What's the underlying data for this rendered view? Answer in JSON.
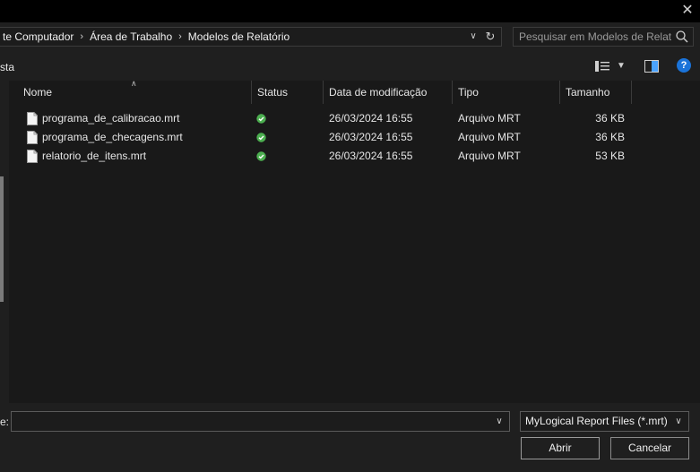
{
  "window": {
    "close_glyph": "✕"
  },
  "addressbar": {
    "crumbs": [
      "te Computador",
      "Área de Trabalho",
      "Modelos de Relatório"
    ],
    "separator": "›"
  },
  "search": {
    "placeholder": "Pesquisar em Modelos de Relat..."
  },
  "toolbar": {
    "label": "sta"
  },
  "columns": [
    "Nome",
    "Status",
    "Data de modificação",
    "Tipo",
    "Tamanho"
  ],
  "files": [
    {
      "name": "programa_de_calibracao.mrt",
      "modified": "26/03/2024 16:55",
      "type": "Arquivo MRT",
      "size": "36 KB"
    },
    {
      "name": "programa_de_checagens.mrt",
      "modified": "26/03/2024 16:55",
      "type": "Arquivo MRT",
      "size": "36 KB"
    },
    {
      "name": "relatorio_de_itens.mrt",
      "modified": "26/03/2024 16:55",
      "type": "Arquivo MRT",
      "size": "53 KB"
    }
  ],
  "footer": {
    "filename_label": "e:",
    "filename_value": "",
    "filetype": "MyLogical Report Files (*.mrt)",
    "open_label": "Abrir",
    "cancel_label": "Cancelar"
  },
  "colors": {
    "status_ok": "#4caf50",
    "help": "#1a73d9",
    "preview_icon": "#4aa3ff"
  },
  "icons": [
    "close-icon",
    "chevron-right-icon",
    "chevron-down-icon",
    "refresh-icon",
    "search-icon",
    "view-details-icon",
    "preview-pane-icon",
    "help-icon",
    "file-icon",
    "status-synced-icon"
  ]
}
